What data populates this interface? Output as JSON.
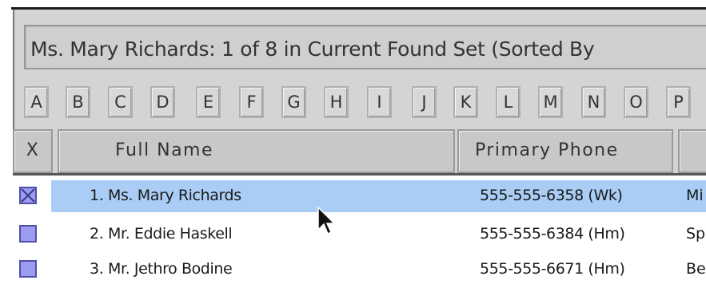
{
  "status": {
    "text": "Ms. Mary Richards:  1 of 8 in Current Found Set (Sorted By"
  },
  "alphabet": [
    "A",
    "B",
    "C",
    "D",
    "E",
    "F",
    "G",
    "H",
    "I",
    "J",
    "K",
    "L",
    "M",
    "N",
    "O",
    "P"
  ],
  "columns": {
    "select": "X",
    "full_name": "Full Name",
    "primary_phone": "Primary Phone"
  },
  "records": [
    {
      "name": "1. Ms. Mary Richards",
      "phone": "555-555-6358 (Wk)",
      "city": "Mi",
      "checked": true,
      "selected": true
    },
    {
      "name": "2. Mr. Eddie Haskell",
      "phone": "555-555-6384 (Hm)",
      "city": "Sp",
      "checked": false,
      "selected": false
    },
    {
      "name": "3. Mr. Jethro Bodine",
      "phone": "555-555-6671 (Hm)",
      "city": "Be",
      "checked": false,
      "selected": false
    }
  ],
  "colors": {
    "selection": "#a9cdf4",
    "checkbox": "#9b9bf2"
  },
  "icons": {
    "cursor": "arrow-cursor-icon"
  }
}
